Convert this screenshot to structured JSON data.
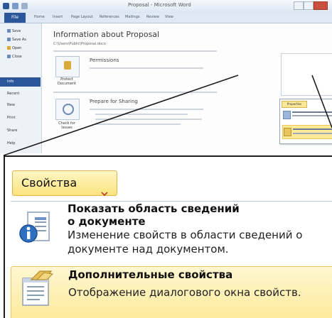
{
  "window": {
    "title": "Proposal - Microsoft Word",
    "tabs": [
      "File",
      "Home",
      "Insert",
      "Page Layout",
      "References",
      "Mailings",
      "Review",
      "View"
    ]
  },
  "backstage": {
    "nav": [
      "Save",
      "Save As",
      "Open",
      "Close",
      "Info",
      "Recent",
      "New",
      "Print",
      "Share",
      "Help"
    ],
    "info_title": "Information about Proposal",
    "info_path": "C:\\Users\\Public\\Proposal.docx",
    "permissions": {
      "heading": "Permissions",
      "button": "Protect Document"
    },
    "prepare": {
      "heading": "Prepare for Sharing",
      "button": "Check for Issues"
    },
    "mini_properties_label": "Properties"
  },
  "zoom": {
    "properties_button": "Свойства",
    "dropdown_arrow": "▾",
    "show_panel": {
      "title_line1": "Показать область сведений",
      "title_line2": "о документе",
      "description": "Изменение свойств в области сведений о документе над документом.",
      "icon": "document-panel-icon"
    },
    "advanced": {
      "title": "Дополнительные свойства",
      "description": "Отображение диалогового окна свойств.",
      "icon": "advanced-properties-icon"
    }
  },
  "colors": {
    "file_tab": "#2b579a",
    "highlight": "#fde998",
    "highlight_border": "#f1c75d"
  }
}
